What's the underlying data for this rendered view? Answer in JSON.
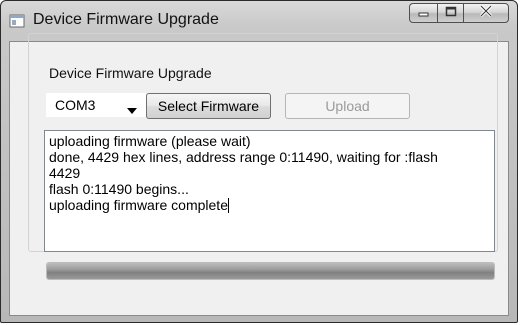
{
  "window": {
    "title": "Device Firmware Upgrade"
  },
  "group": {
    "legend": "Device Firmware Upgrade"
  },
  "controls": {
    "port": "COM3",
    "select_label": "Select Firmware",
    "upload_label": "Upload",
    "upload_enabled": false
  },
  "log": {
    "lines": [
      "uploading firmware (please wait)",
      "done, 4429 hex lines, address range 0:11490, waiting for :flash",
      "4429",
      "flash 0:11490 begins...",
      "uploading firmware complete"
    ]
  },
  "progress": {
    "fraction": 1.0
  },
  "icons": {
    "app": "device-window-icon",
    "minimize": "minimize-icon",
    "maximize": "maximize-icon",
    "close": "close-icon",
    "dropdown": "chevron-down-icon"
  }
}
